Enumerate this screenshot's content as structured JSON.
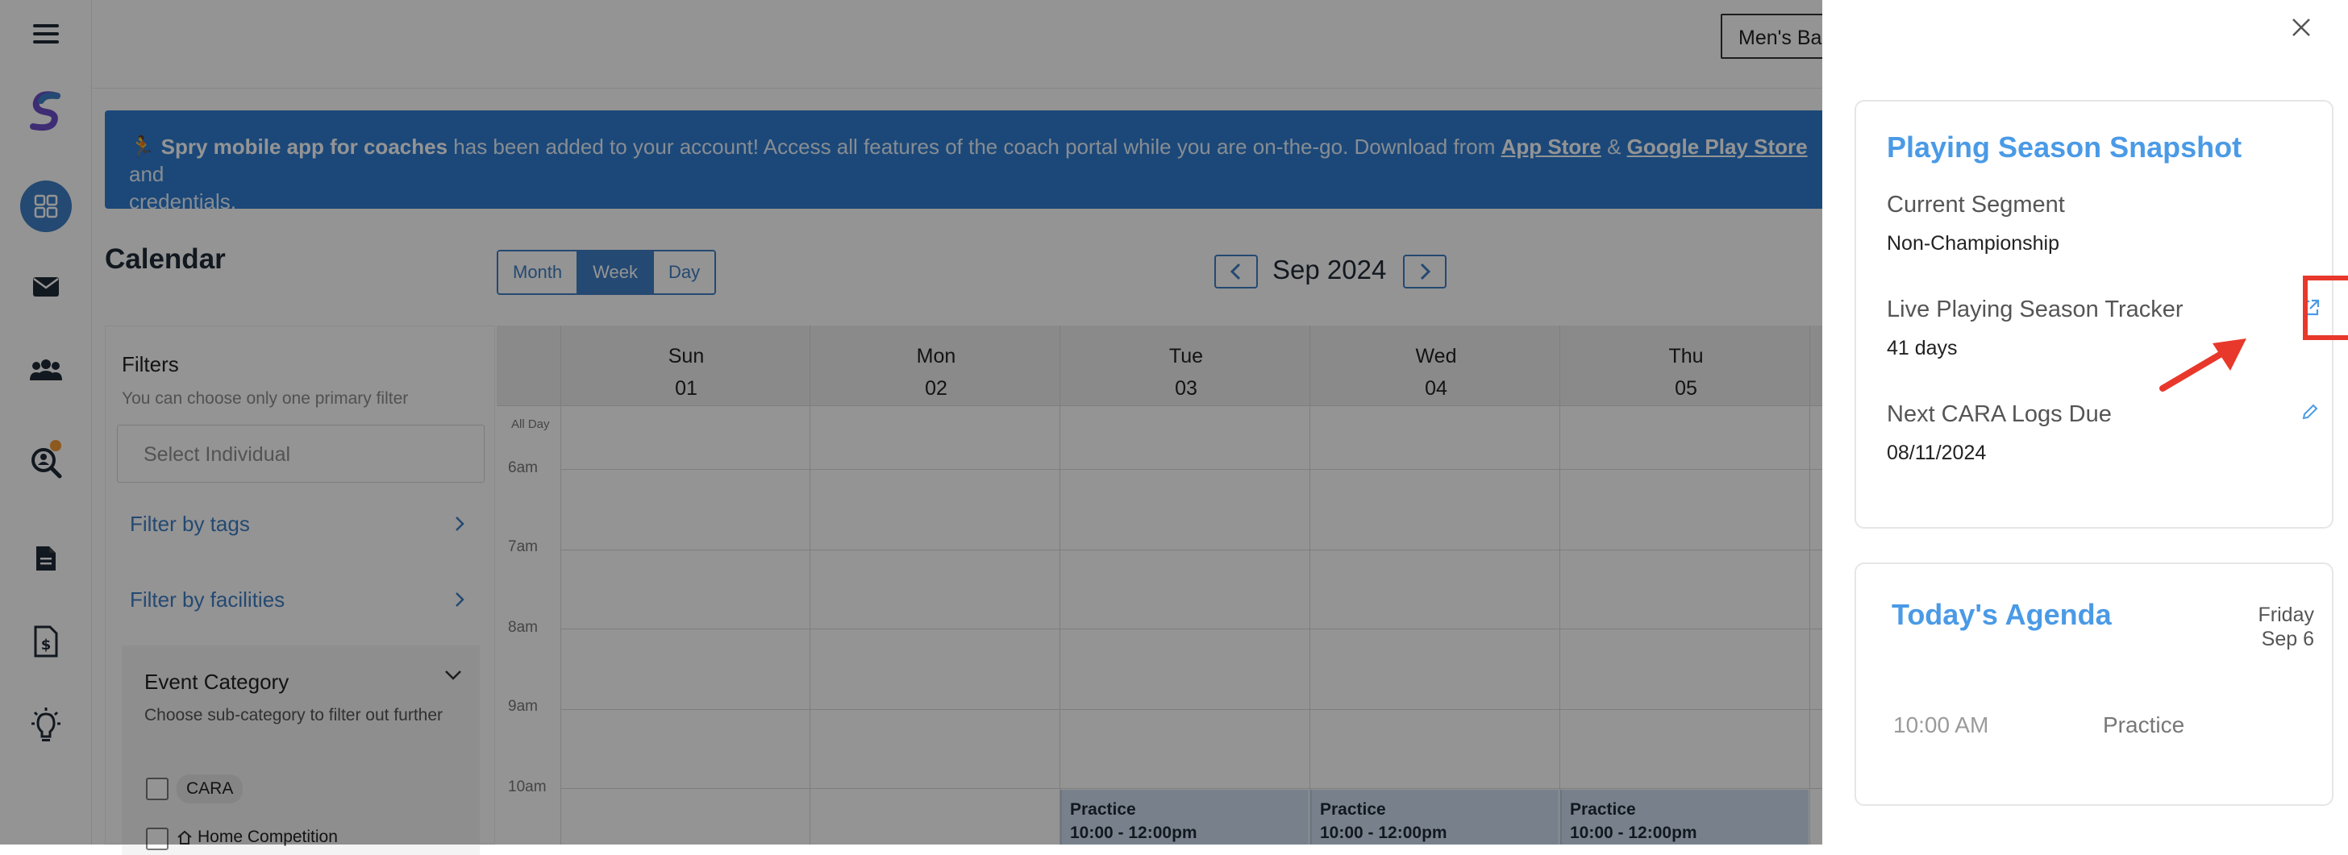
{
  "app": {
    "team_select": "Men's Ba"
  },
  "banner": {
    "emoji": "🏃",
    "bold": "Spry mobile app for coaches",
    "text1": " has been added to your account! Access all features of the coach portal while you are on-the-go. Download from ",
    "app_store": "App Store",
    "amp": " & ",
    "play_store": "Google Play Store",
    "text2": " and",
    "text3": "credentials."
  },
  "calendar": {
    "title": "Calendar",
    "views": [
      "Month",
      "Week",
      "Day"
    ],
    "active_view": "Week",
    "month_label": "Sep 2024",
    "days": [
      {
        "name": "Sun",
        "num": "01"
      },
      {
        "name": "Mon",
        "num": "02"
      },
      {
        "name": "Tue",
        "num": "03"
      },
      {
        "name": "Wed",
        "num": "04"
      },
      {
        "name": "Thu",
        "num": "05"
      }
    ],
    "times": [
      "All Day",
      "6am",
      "7am",
      "8am",
      "9am",
      "10am"
    ],
    "events": [
      {
        "title": "Practice",
        "time": "10:00 - 12:00pm"
      },
      {
        "title": "Practice",
        "time": "10:00 - 12:00pm"
      },
      {
        "title": "Practice",
        "time": "10:00 - 12:00pm"
      }
    ]
  },
  "filters": {
    "title": "Filters",
    "subtitle": "You can choose only one primary filter",
    "select_placeholder": "Select Individual",
    "filter_tags": "Filter by tags",
    "filter_facilities": "Filter by facilities",
    "event_category": {
      "title": "Event Category",
      "subtitle": "Choose sub-category to filter out further",
      "items": [
        "CARA",
        "Home Competition"
      ]
    }
  },
  "snapshot": {
    "title": "Playing Season Snapshot",
    "current_segment_label": "Current Segment",
    "current_segment_value": "Non-Championship",
    "tracker_label": "Live Playing Season Tracker",
    "tracker_value": "41 days",
    "cara_label": "Next CARA Logs Due",
    "cara_value": "08/11/2024"
  },
  "agenda": {
    "title": "Today's Agenda",
    "weekday": "Friday",
    "date": "Sep 6",
    "items": [
      {
        "time": "10:00 AM",
        "event": "Practice"
      }
    ]
  },
  "colors": {
    "accent": "#3f7fc4",
    "banner": "#2f7cd1",
    "title_blue": "#4a9ae6",
    "highlight_red": "#e8382b"
  }
}
